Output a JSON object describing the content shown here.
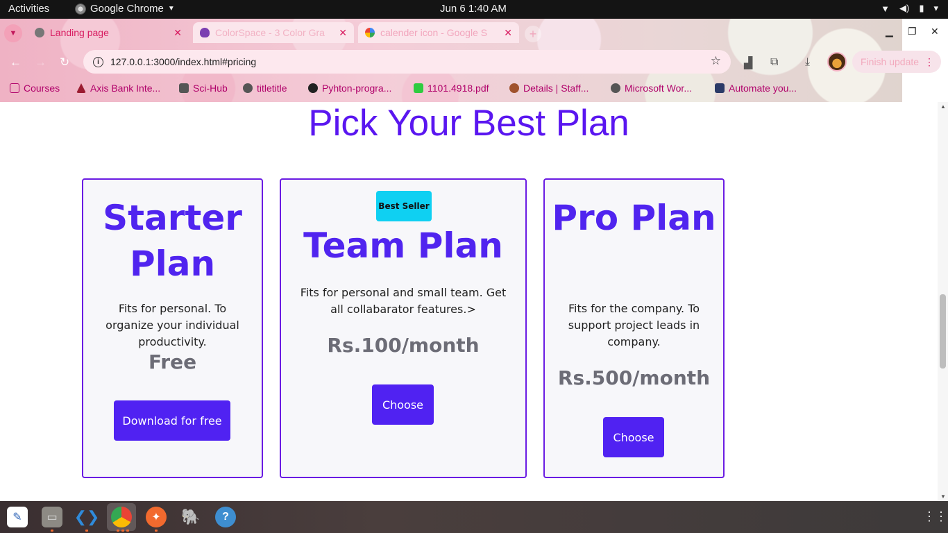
{
  "topbar": {
    "activities": "Activities",
    "app_name": "Google Chrome",
    "clock": "Jun 6   1:40 AM"
  },
  "browser": {
    "tabs": [
      {
        "label": "Landing page",
        "active": true
      },
      {
        "label": "ColorSpace - 3 Color Gra",
        "active": false
      },
      {
        "label": "calender icon - Google S",
        "active": false
      }
    ],
    "url": "127.0.0.1:3000/index.html#pricing",
    "finish_update": "Finish update",
    "bookmarks": [
      {
        "label": "Courses",
        "icon": "folder-icon"
      },
      {
        "label": "Axis Bank Inte...",
        "icon": "axis-bank-icon"
      },
      {
        "label": "Sci-Hub",
        "icon": "scihub-icon"
      },
      {
        "label": "titletitle",
        "icon": "globe-icon"
      },
      {
        "label": "Pyhton-progra...",
        "icon": "github-icon"
      },
      {
        "label": "1101.4918.pdf",
        "icon": "smiley-icon"
      },
      {
        "label": "Details | Staff...",
        "icon": "emblem-icon"
      },
      {
        "label": "Microsoft Wor...",
        "icon": "globe-icon"
      },
      {
        "label": "Automate you...",
        "icon": "tds-icon"
      }
    ]
  },
  "page": {
    "title": "Pick Your Best Plan",
    "plans": [
      {
        "title": "Starter Plan",
        "description": "Fits for personal. To organize your individual productivity.",
        "price": "Free",
        "button": "Download for free"
      },
      {
        "badge": "Best Seller",
        "title": "Team Plan",
        "description": "Fits for personal and small team. Get all collabarator features.>",
        "price": "Rs.100/month",
        "button": "Choose"
      },
      {
        "title": "Pro Plan",
        "description": "Fits for the company. To support project leads in company.",
        "price": "Rs.500/month",
        "button": "Choose"
      }
    ]
  },
  "colors": {
    "accent": "#5022f2",
    "title": "#5a16f0",
    "badge": "#0fd0f2",
    "card_border": "#6a1be3"
  }
}
